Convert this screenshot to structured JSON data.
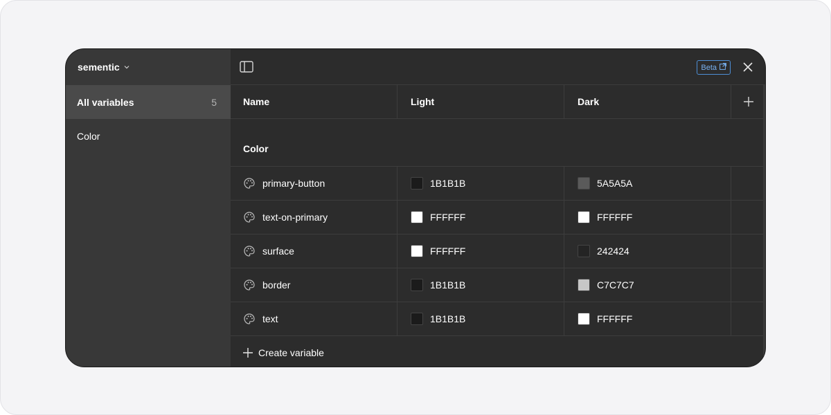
{
  "sidebar": {
    "collection_name": "sementic",
    "items": [
      {
        "label": "All variables",
        "count": "5"
      },
      {
        "label": "Color"
      }
    ]
  },
  "header": {
    "beta_label": "Beta"
  },
  "table": {
    "columns": [
      "Name",
      "Light",
      "Dark"
    ],
    "group_label": "Color",
    "rows": [
      {
        "name": "primary-button",
        "light": "1B1B1B",
        "dark": "5A5A5A"
      },
      {
        "name": "text-on-primary",
        "light": "FFFFFF",
        "dark": "FFFFFF"
      },
      {
        "name": "surface",
        "light": "FFFFFF",
        "dark": "242424"
      },
      {
        "name": "border",
        "light": "1B1B1B",
        "dark": "C7C7C7"
      },
      {
        "name": "text",
        "light": "1B1B1B",
        "dark": "FFFFFF"
      }
    ],
    "create_label": "Create variable"
  },
  "colors": {
    "panel_bg": "#2c2c2c",
    "sidebar_bg": "#383838",
    "active_item_bg": "#4a4a4a",
    "beta_accent": "#4d8fd6"
  }
}
